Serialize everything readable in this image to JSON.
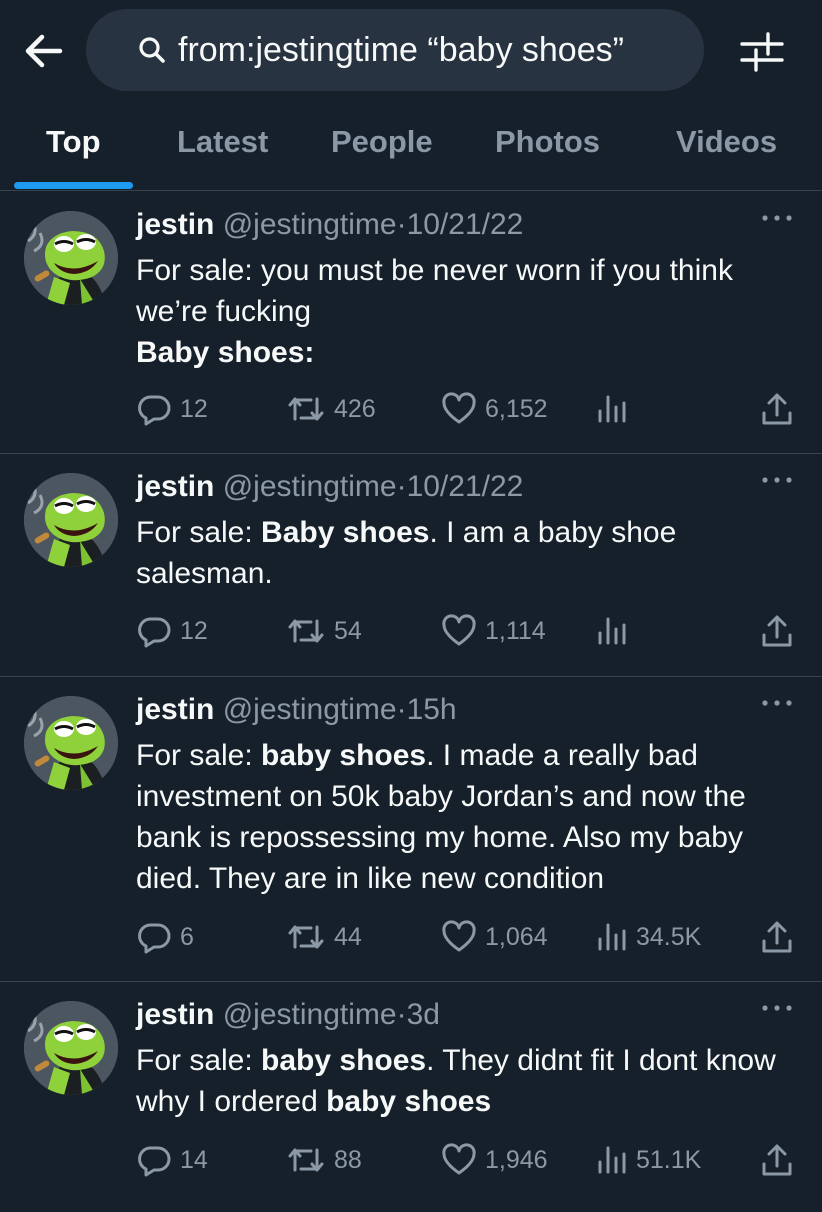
{
  "search": {
    "query": "from:jestingtime “baby shoes”"
  },
  "tabs": [
    {
      "label": "Top",
      "active": true
    },
    {
      "label": "Latest",
      "active": false
    },
    {
      "label": "People",
      "active": false
    },
    {
      "label": "Photos",
      "active": false
    },
    {
      "label": "Videos",
      "active": false
    }
  ],
  "tweets": [
    {
      "name": "jestin",
      "handle": "@jestingtime",
      "sep": "·",
      "time": "10/21/22",
      "text_a": "For sale: you must be never worn if you think we’re fucking",
      "text_b": "Baby shoes:",
      "replies": "12",
      "retweets": "426",
      "likes": "6,152",
      "views": ""
    },
    {
      "name": "jestin",
      "handle": "@jestingtime",
      "sep": "·",
      "time": "10/21/22",
      "text_a": "For sale: ",
      "text_b": "Baby shoes",
      "text_c": ". I am a baby shoe salesman.",
      "replies": "12",
      "retweets": "54",
      "likes": "1,114",
      "views": ""
    },
    {
      "name": "jestin",
      "handle": "@jestingtime",
      "sep": "·",
      "time": "15h",
      "text_a": "For sale: ",
      "text_b": "baby shoes",
      "text_c": ". I made a really bad investment on 50k baby Jordan’s and now the bank is repossessing my home. Also my baby died. They are in like new condition",
      "replies": "6",
      "retweets": "44",
      "likes": "1,064",
      "views": "34.5K"
    },
    {
      "name": "jestin",
      "handle": "@jestingtime",
      "sep": "·",
      "time": "3d",
      "text_a": "For sale: ",
      "text_b": "baby shoes",
      "text_c": ". They didnt fit I dont know why I ordered ",
      "text_d": "baby shoes",
      "replies": "14",
      "retweets": "88",
      "likes": "1,946",
      "views": "51.1K"
    }
  ],
  "icons": {
    "back": "arrow-left-icon",
    "search": "search-icon",
    "filter": "sliders-icon",
    "more": "more-horizontal-icon",
    "reply": "reply-icon",
    "retweet": "retweet-icon",
    "like": "heart-icon",
    "views": "views-icon",
    "share": "share-icon"
  },
  "colors": {
    "background": "#15202b",
    "accent": "#1d9bf0",
    "secondary_text": "#8b98a5",
    "divider": "#38444d"
  }
}
